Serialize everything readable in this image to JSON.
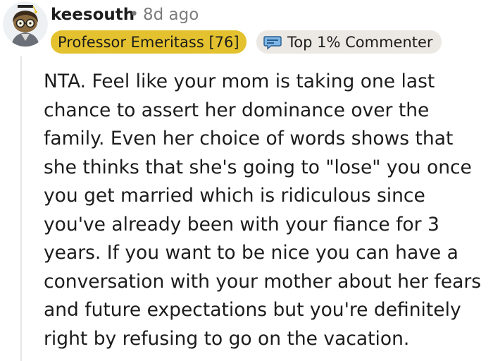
{
  "comment": {
    "author": {
      "username": "keesouth",
      "avatar_icon": "snoo-avatar-icon"
    },
    "separator": "•",
    "age": "8d ago",
    "flair": {
      "label": "Professor Emeritass [76]",
      "color": "#e4c22f"
    },
    "badge": {
      "label": "Top 1% Commenter",
      "icon": "commenter-badge-icon",
      "color": "#ece9e4"
    },
    "body": "NTA. Feel like your mom is taking one last chance to assert her dominance over the family. Even her choice of words shows that she thinks that she's going to \"lose\" you once you get married which is ridiculous since you've already been with your fiance for 3 years. If you want to be nice you can have a conversation with your mother about her fears and future expectations but you're definitely right by refusing to go on the vacation."
  }
}
